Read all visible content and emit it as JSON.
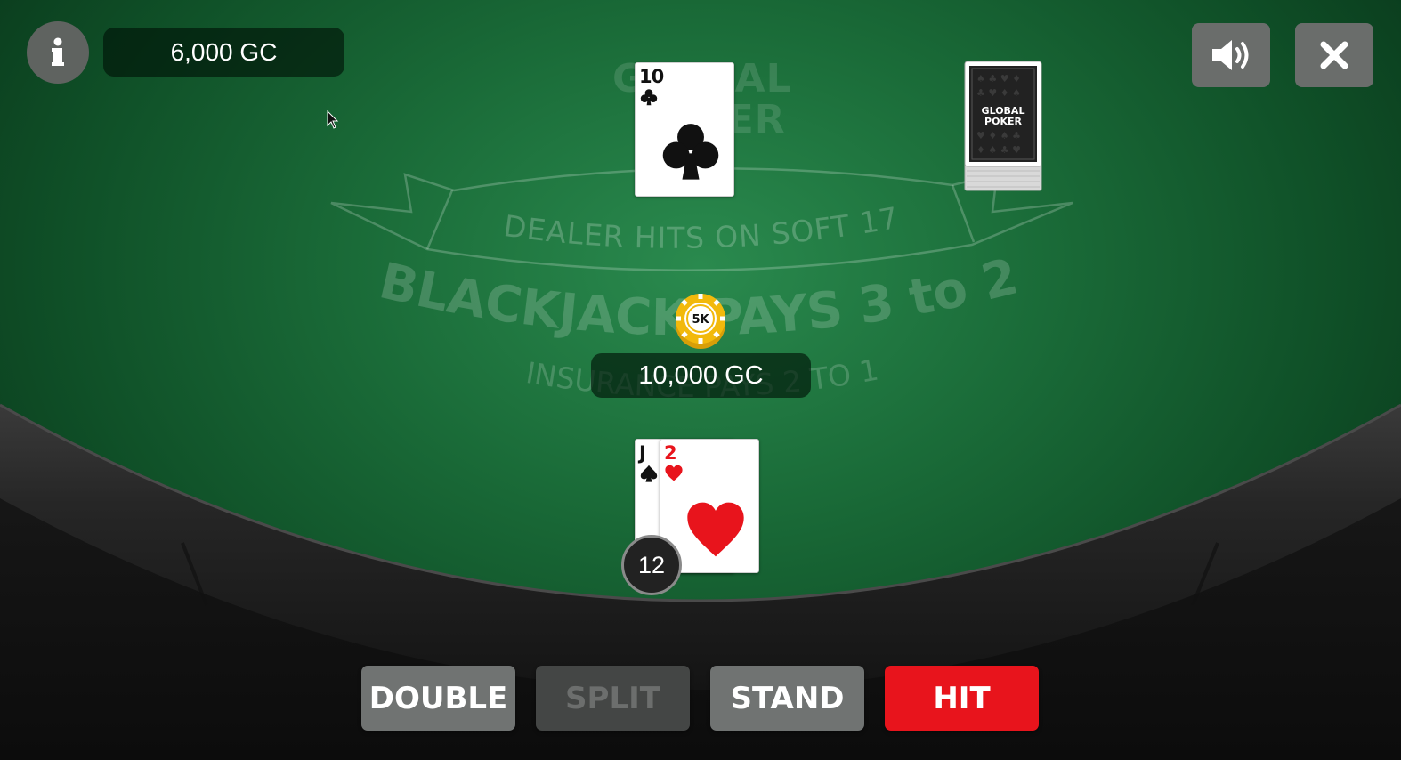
{
  "header": {
    "balance": "6,000 GC",
    "info_icon": "info-icon",
    "sound_icon": "volume-icon",
    "close_icon": "close-icon"
  },
  "table": {
    "watermark_line1": "GLOBAL",
    "watermark_line2": "POKER",
    "banner_text": "DEALER HITS ON SOFT 17",
    "payout_text": "BLACKJACK PAYS 3 to 2",
    "insurance_text": "INSURANCE PAYS 2 TO 1",
    "felt_color": "#1a6b38",
    "rail_color": "#1f1f1f"
  },
  "dealer": {
    "cards": [
      {
        "rank": "10",
        "suit": "clubs",
        "color": "#111111"
      }
    ]
  },
  "shoe": {
    "brand_line1": "GLOBAL",
    "brand_line2": "POKER"
  },
  "bet": {
    "chip_label": "5K",
    "chip_color": "#f2b90c",
    "amount": "10,000 GC"
  },
  "player": {
    "cards": [
      {
        "rank": "J",
        "suit": "spades",
        "color": "#111111"
      },
      {
        "rank": "2",
        "suit": "hearts",
        "color": "#e8141c"
      }
    ],
    "total": "12"
  },
  "actions": {
    "double": "DOUBLE",
    "split": "SPLIT",
    "stand": "STAND",
    "hit": "HIT",
    "hit_color": "#e8141c"
  }
}
